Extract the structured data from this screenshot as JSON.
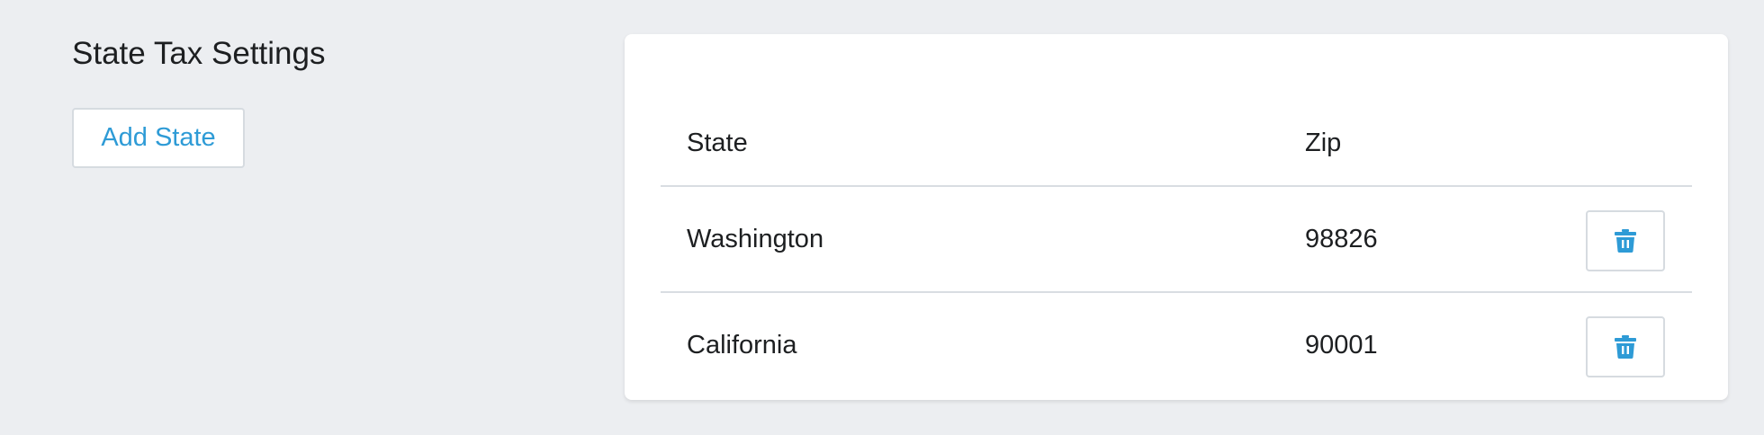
{
  "page": {
    "title": "State Tax Settings",
    "add_button_label": "Add State"
  },
  "table": {
    "columns": [
      "State",
      "Zip"
    ],
    "rows": [
      {
        "state": "Washington",
        "zip": "98826",
        "action_icon": "trash-icon"
      },
      {
        "state": "California",
        "zip": "90001",
        "action_icon": "trash-icon"
      }
    ]
  },
  "colors": {
    "background": "#eceef1",
    "card": "#ffffff",
    "accent": "#2e9bd6",
    "border": "#d6dbe0",
    "text": "#1d1f21"
  }
}
